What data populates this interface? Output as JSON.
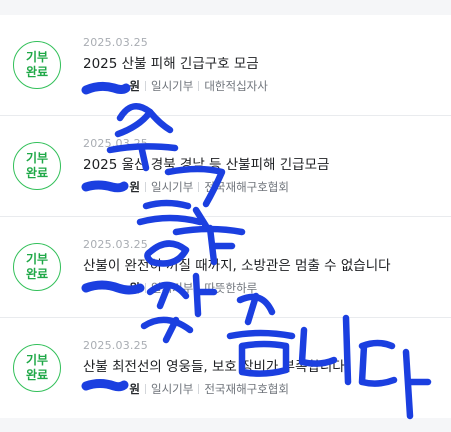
{
  "items": [
    {
      "badge_line1": "기부",
      "badge_line2": "완료",
      "date": "2025.03.25",
      "title": "2025 산불 피해 긴급구호 모금",
      "amount": "원",
      "type": "일시기부",
      "org": "대한적십자사"
    },
    {
      "badge_line1": "기부",
      "badge_line2": "완료",
      "date": "2025.03.25",
      "title": "2025 울산 경북 경남 등 산불피해 긴급모금",
      "amount": "원",
      "type": "일시기부",
      "org": "전국재해구호협회"
    },
    {
      "badge_line1": "기부",
      "badge_line2": "완료",
      "date": "2025.03.25",
      "title": "산불이 완전히 꺼질 때까지, 소방관은 멈출 수 없습니다",
      "amount": "원",
      "type": "일시기부",
      "org": "따뜻한하루"
    },
    {
      "badge_line1": "기부",
      "badge_line2": "완료",
      "date": "2025.03.25",
      "title": "산불 최전선의 영웅들, 보호 장비가 부족합니다",
      "amount": "원",
      "type": "일시기부",
      "org": "전국재해구호협회"
    }
  ],
  "colors": {
    "badge": "#1fa847",
    "scribble": "#1b3fe0"
  },
  "overlay": {
    "handwriting": "수고하셨습니다"
  }
}
